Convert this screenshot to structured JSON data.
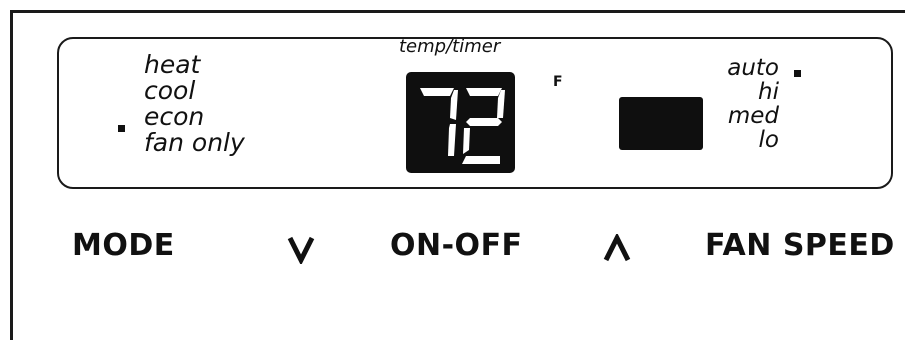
{
  "display": {
    "temp_label": "temp/timer",
    "temperature": "72",
    "unit": "F",
    "modes": [
      "heat",
      "cool",
      "econ",
      "fan only"
    ],
    "selected_mode": "econ",
    "fan_speeds": [
      "auto",
      "hi",
      "med",
      "lo"
    ],
    "selected_fan_speed": "auto",
    "indicator_color": "#111111",
    "screen_color": "#0f0f0f"
  },
  "buttons": {
    "mode": "MODE",
    "down": "V",
    "power": "ON-OFF",
    "up": "Λ",
    "fan_speed": "FAN SPEED"
  }
}
